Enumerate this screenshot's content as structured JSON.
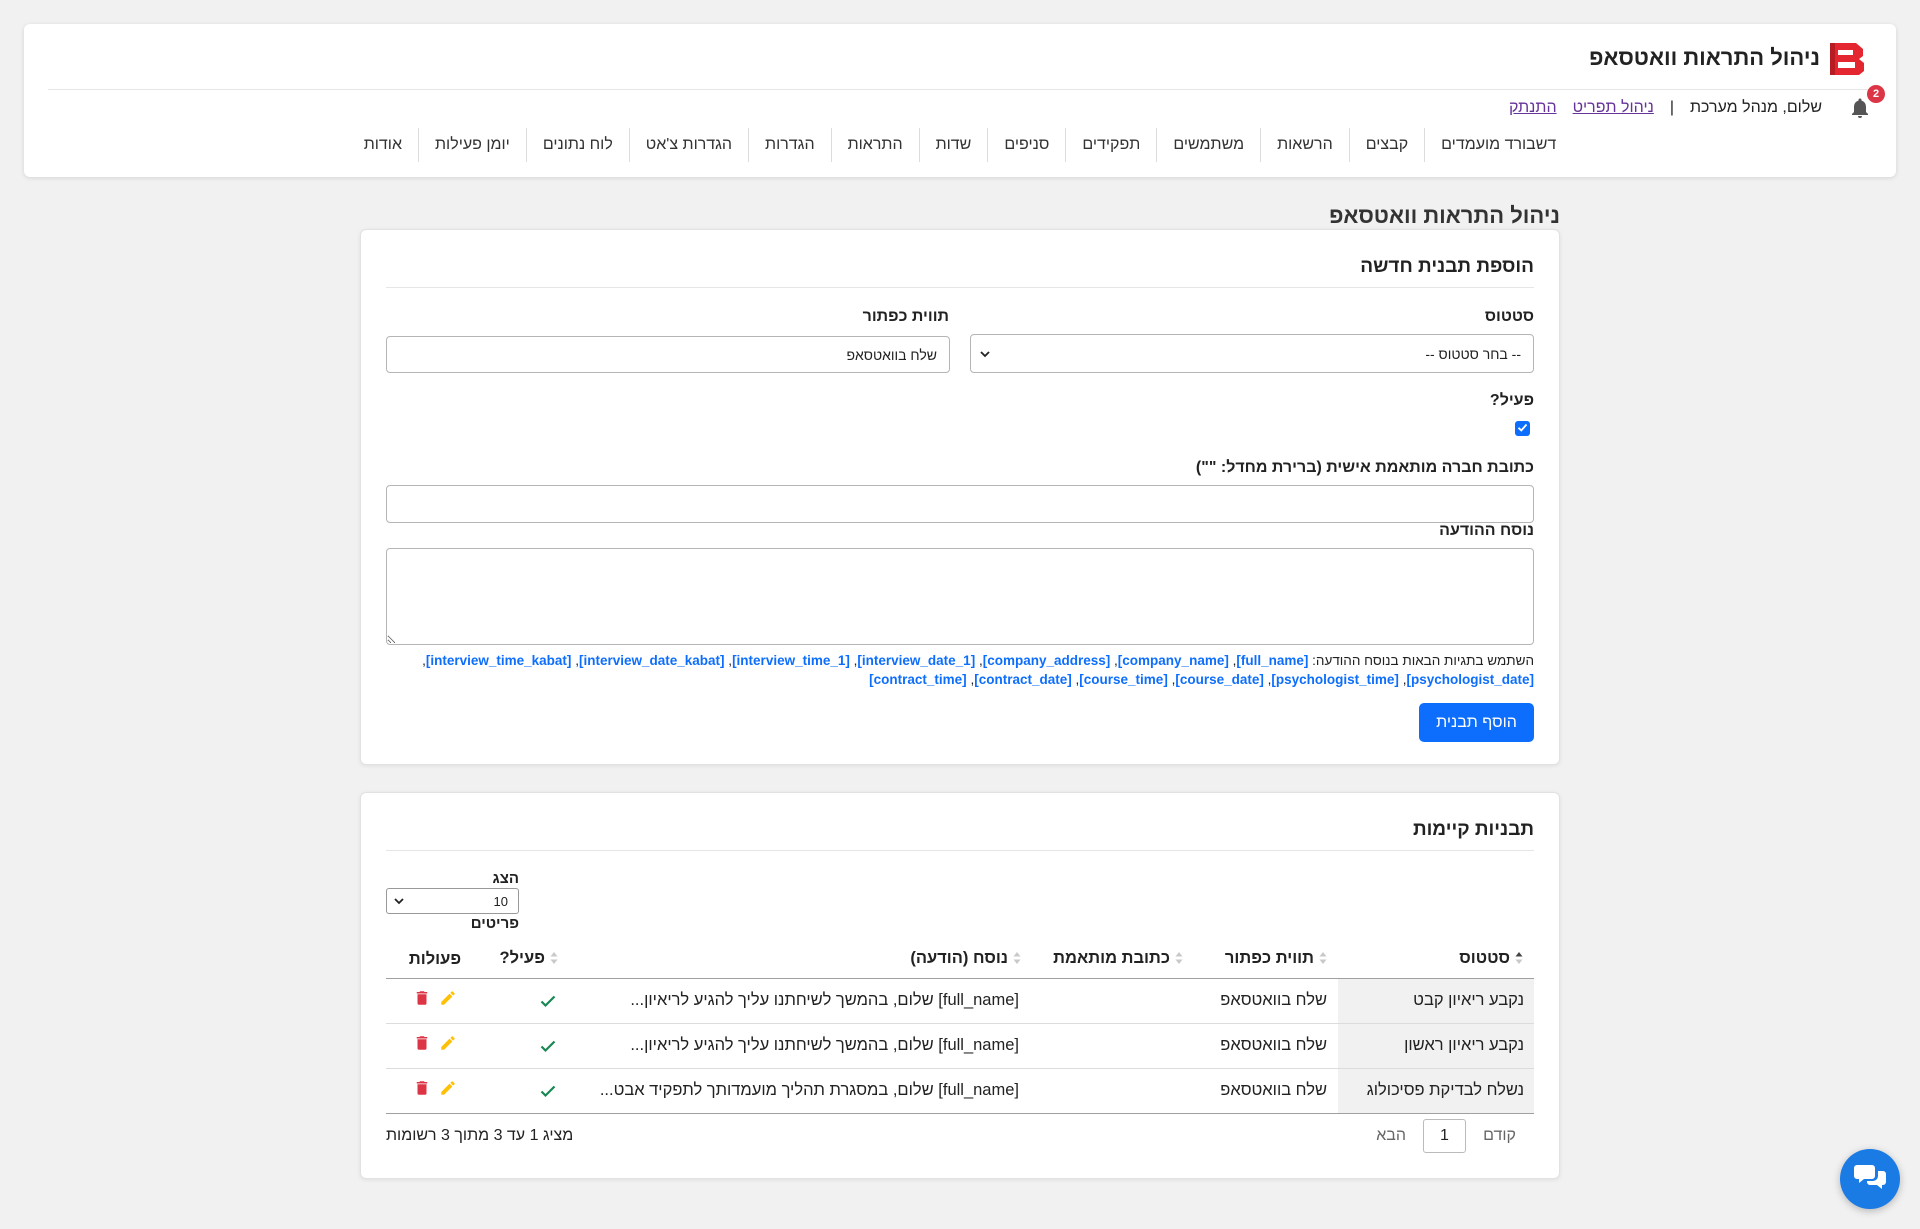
{
  "header": {
    "app_title": "ניהול התראות וואטסאפ",
    "notifications_count": "2",
    "greeting": "שלום, מנהל מערכת",
    "separator": "|",
    "menu_link": "ניהול תפריט",
    "logout_link": "התנתק"
  },
  "nav": {
    "items": [
      "דשבורד מועמדים",
      "קבצים",
      "הרשאות",
      "משתמשים",
      "תפקידים",
      "סניפים",
      "שדות",
      "התראות",
      "הגדרות",
      "הגדרות צ'אט",
      "לוח נתונים",
      "יומן פעילות",
      "אודות"
    ]
  },
  "page_title": "ניהול התראות וואטסאפ",
  "add_form": {
    "title": "הוספת תבנית חדשה",
    "status_label": "סטטוס",
    "status_value": "-- בחר סטטוס --",
    "button_label_label": "תווית כפתור",
    "button_label_value": "שלח בוואטסאפ",
    "active_label": "פעיל?",
    "active_checked": true,
    "company_address_label": "כתובת חברה מותאמת אישית (ברירת מחדל: \"\")",
    "company_address_value": "",
    "message_label": "נוסח ההודעה",
    "message_value": "",
    "help_prefix": "השתמש בתגיות הבאות בנוסח ההודעה:",
    "tags": [
      "[full_name]",
      "[company_name]",
      "[company_address]",
      "[interview_date_1]",
      "[interview_time_1]",
      "[interview_date_kabat]",
      "[interview_time_kabat]",
      "[psychologist_date]",
      "[psychologist_time]",
      "[course_date]",
      "[course_time]",
      "[contract_date]",
      "[contract_time]"
    ],
    "tag_separator": ",",
    "submit_label": "הוסף תבנית"
  },
  "templates": {
    "title": "תבניות קיימות",
    "show_label": "הצג",
    "page_size": "10",
    "items_label": "פריטים",
    "columns": [
      "סטטוס",
      "תווית כפתור",
      "כתובת מותאמת",
      "נוסח (הודעה)",
      "פעיל?",
      "פעולות"
    ],
    "sort": {
      "column": "סטטוס",
      "direction": "asc"
    },
    "rows": [
      {
        "status": "נקבע ריאיון קבט",
        "button_label": "שלח בוואטסאפ",
        "custom_address": "",
        "message": "[full_name] שלום, בהמשך לשיחתנו עליך להגיע לריאיון...",
        "active": true
      },
      {
        "status": "נקבע ריאיון ראשון",
        "button_label": "שלח בוואטסאפ",
        "custom_address": "",
        "message": "[full_name] שלום, בהמשך לשיחתנו עליך להגיע לריאיון...",
        "active": true
      },
      {
        "status": "נשלח לבדיקת פסיכולוג",
        "button_label": "שלח בוואטסאפ",
        "custom_address": "",
        "message": "[full_name] שלום, במסגרת תהליך מועמדותך לתפקיד אבט...",
        "active": true
      }
    ],
    "info": "מציג 1 עד 3 מתוך 3 רשומות",
    "pagination": {
      "previous": "קודם",
      "current_page": "1",
      "next": "הבא"
    }
  },
  "colors": {
    "accent": "#0d6efd",
    "danger": "#dc3545",
    "warning": "#ffc107",
    "success": "#198754",
    "visited_link": "#663399",
    "chat_button": "#1a7be5"
  },
  "icons": [
    "logo-icon",
    "bell-icon",
    "chevron-down-icon",
    "checkbox-check-icon",
    "sort-icon",
    "check-icon",
    "edit-icon",
    "delete-icon",
    "chat-icon"
  ]
}
